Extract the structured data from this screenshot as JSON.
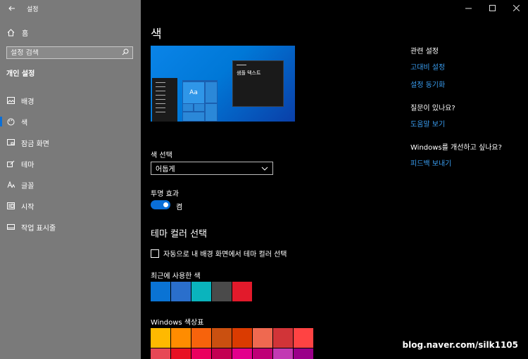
{
  "window": {
    "title": "설정"
  },
  "sidebar": {
    "home": "홈",
    "search_placeholder": "설정 검색",
    "section_title": "개인 설정",
    "items": [
      {
        "label": "배경",
        "icon": "image-icon"
      },
      {
        "label": "색",
        "icon": "palette-icon",
        "active": true
      },
      {
        "label": "잠금 화면",
        "icon": "lock-screen-icon"
      },
      {
        "label": "테마",
        "icon": "theme-brush-icon"
      },
      {
        "label": "글꼴",
        "icon": "font-icon"
      },
      {
        "label": "시작",
        "icon": "start-menu-icon"
      },
      {
        "label": "작업 표시줄",
        "icon": "taskbar-icon"
      }
    ]
  },
  "main": {
    "title": "색",
    "preview_text": "샘플 텍스트",
    "preview_tile": "Aa",
    "color_select_label": "색 선택",
    "color_select_value": "어둡게",
    "transparency_label": "투명 효과",
    "transparency_state": "켬",
    "theme_color_heading": "테마 컬러 선택",
    "auto_checkbox_label": "자동으로 내 배경 화면에서 테마 컬러 선택",
    "recent_label": "최근에 사용한 색",
    "recent_colors": [
      "#0a73d4",
      "#2a6fcc",
      "#0ab4bd",
      "#4a4a4a",
      "#e21a2b"
    ],
    "palette_label": "Windows 색상표",
    "palette_row1": [
      "#ffb900",
      "#ff8c00",
      "#f7630c",
      "#ca5010",
      "#da3b01",
      "#ef6950",
      "#d13438",
      "#ff4343"
    ],
    "palette_row2": [
      "#e74856",
      "#e81123",
      "#ea005e",
      "#c30052",
      "#e3008c",
      "#bf0077",
      "#c239b3",
      "#9a0089"
    ]
  },
  "related": {
    "heading": "관련 설정",
    "links": [
      "고대비 설정",
      "설정 동기화"
    ],
    "question_heading": "질문이 있나요?",
    "help_link": "도움말 보기",
    "improve_heading": "Windows를 개선하고 싶나요?",
    "feedback_link": "피드백 보내기"
  },
  "watermark": "blog.naver.com/silk1105",
  "colors": {
    "accent": "#0a6fd8",
    "link": "#3a9df0",
    "sidebar_bg": "#7a7a7a"
  }
}
